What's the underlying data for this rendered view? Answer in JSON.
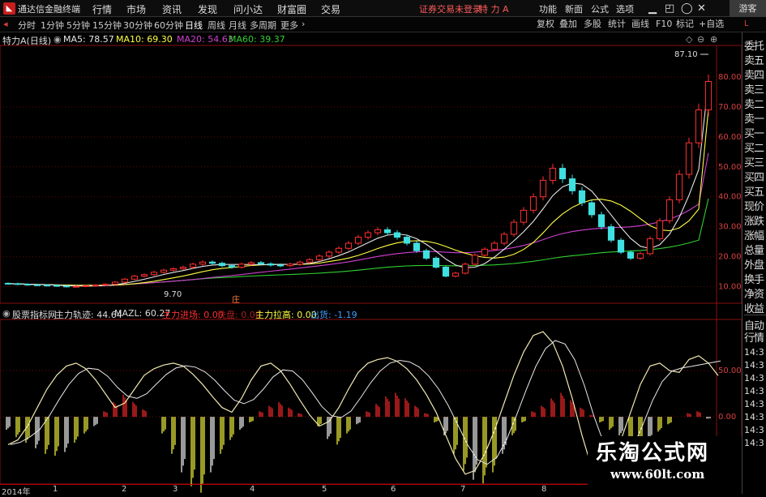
{
  "menubar": {
    "app_title": "通达信金融终端",
    "items": [
      "行情",
      "市场",
      "资讯",
      "发现",
      "问小达",
      "财富圈",
      "交易"
    ],
    "trade_warning": "证券交易未登录",
    "stock_name": "特 力 A",
    "right_items": [
      "功能",
      "新面",
      "公式",
      "选项"
    ],
    "guest": "游客"
  },
  "tabs": [
    "分时",
    "1分钟",
    "5分钟",
    "15分钟",
    "30分钟",
    "60分钟",
    "日线",
    "周线",
    "月线",
    "多周期",
    "更多"
  ],
  "active_tab": "日线",
  "right_tools": [
    "复权",
    "叠加",
    "多股",
    "统计",
    "画线",
    "F10",
    "标记",
    "+自选"
  ],
  "main_chart": {
    "title": "特力A(日线)",
    "ma": [
      {
        "label": "MA5: 78.57",
        "color": "#e6e6e6"
      },
      {
        "label": "MA10: 69.30",
        "color": "#ffff40"
      },
      {
        "label": "MA20: 54.63",
        "color": "#d040d0"
      },
      {
        "label": "MA60: 39.37",
        "color": "#30d030"
      }
    ],
    "y_labels": [
      "80.00",
      "70.00",
      "60.00",
      "50.00",
      "40.00",
      "30.00",
      "20.00",
      "10.00"
    ],
    "high_label": "87.10",
    "low_label": "9.70",
    "marker_label": "庄"
  },
  "sub_chart": {
    "title": "股票指标网",
    "items": [
      {
        "label": "主力轨迹: 44.64",
        "color": "#dddddd"
      },
      {
        "label": "MAZL: 60.27",
        "color": "#dddddd"
      },
      {
        "label": "主力进场: 0.00",
        "color": "#ff3030"
      },
      {
        "label": "洗盘: 0.00",
        "color": "#aa2020"
      },
      {
        "label": "主力拉高: 0.00",
        "color": "#ffff40"
      },
      {
        "label": "出货: -1.19",
        "color": "#40a0ff"
      }
    ],
    "y_labels": [
      "50.00",
      "0.00"
    ]
  },
  "right_panel": {
    "items": [
      "委托",
      "卖五",
      "卖四",
      "卖三",
      "卖二",
      "卖一",
      "买一",
      "买二",
      "买三",
      "买四",
      "买五",
      "现价",
      "涨跌",
      "涨幅",
      "总量",
      "外盘",
      "换手",
      "净资",
      "收益",
      "自动",
      "行情"
    ],
    "times": [
      "14:3",
      "14:3",
      "14:3",
      "14:3",
      "14:3",
      "14:3",
      "14:3",
      "14:3"
    ]
  },
  "time_axis": [
    "2014年",
    "1",
    "2",
    "3",
    "4",
    "5",
    "6",
    "7",
    "8"
  ],
  "watermark": {
    "title": "乐淘公式网",
    "url": "www.60lt.com"
  },
  "chart_data": {
    "type": "candlestick",
    "price_ylim": [
      5,
      90
    ],
    "closes": [
      11.0,
      10.8,
      10.6,
      10.5,
      10.4,
      10.2,
      10.0,
      10.1,
      10.3,
      10.5,
      10.8,
      11.5,
      12.5,
      13.5,
      14.0,
      14.8,
      15.5,
      16.0,
      16.5,
      17.5,
      18.2,
      17.8,
      17.0,
      16.5,
      17.5,
      18.0,
      17.6,
      17.2,
      17.0,
      17.5,
      18.2,
      19.0,
      20.2,
      21.5,
      22.8,
      24.5,
      26.5,
      28.0,
      29.0,
      28.0,
      26.5,
      24.5,
      22.0,
      19.5,
      16.5,
      13.5,
      14.5,
      17.5,
      20.5,
      22.5,
      24.5,
      27.5,
      31.5,
      35.5,
      40.0,
      45.5,
      49.5,
      46.0,
      42.0,
      38.0,
      34.0,
      30.0,
      25.5,
      21.5,
      19.5,
      21.0,
      26.0,
      32.0,
      39.0,
      47.5,
      58.0,
      69.0,
      78.5
    ],
    "ma5_last": 78.57,
    "ma10_last": 69.3,
    "ma20_last": 54.63,
    "ma60_last": 39.37,
    "indicator_ylim": [
      -70,
      100
    ],
    "indicator_last": {
      "主力轨迹": 44.64,
      "MAZL": 60.27,
      "主力进场": 0.0,
      "洗盘": 0.0,
      "主力拉高": 0.0,
      "出货": -1.19
    },
    "indicator_bars": [
      -14,
      -22,
      -28,
      -34,
      -40,
      -42,
      -38,
      -28,
      -18,
      -10,
      6,
      16,
      24,
      16,
      8,
      0,
      -18,
      -40,
      -60,
      -75,
      -82,
      -60,
      -40,
      -25,
      -14,
      -6,
      6,
      12,
      16,
      10,
      4,
      0,
      -10,
      -24,
      -30,
      -18,
      -8,
      6,
      14,
      22,
      26,
      20,
      12,
      4,
      -6,
      -20,
      -40,
      -58,
      -68,
      -72,
      -60,
      -40,
      -20,
      -6,
      6,
      12,
      20,
      26,
      18,
      10,
      2,
      -6,
      -14,
      -20,
      -28,
      -32,
      -26,
      -16,
      -8,
      0,
      4,
      6,
      -2
    ],
    "indicator_line": [
      -30,
      -25,
      -10,
      10,
      30,
      45,
      55,
      58,
      52,
      40,
      25,
      10,
      15,
      30,
      45,
      52,
      56,
      58,
      55,
      46,
      35,
      22,
      10,
      5,
      20,
      40,
      55,
      58,
      50,
      35,
      18,
      2,
      -10,
      -5,
      10,
      30,
      48,
      58,
      62,
      64,
      60,
      52,
      40,
      24,
      5,
      -20,
      -45,
      -62,
      -58,
      -40,
      -15,
      15,
      45,
      70,
      88,
      92,
      80,
      55,
      20,
      -20,
      -55,
      -60,
      -50,
      -25,
      5,
      35,
      55,
      58,
      50,
      48,
      62,
      66,
      58,
      44.64
    ]
  }
}
